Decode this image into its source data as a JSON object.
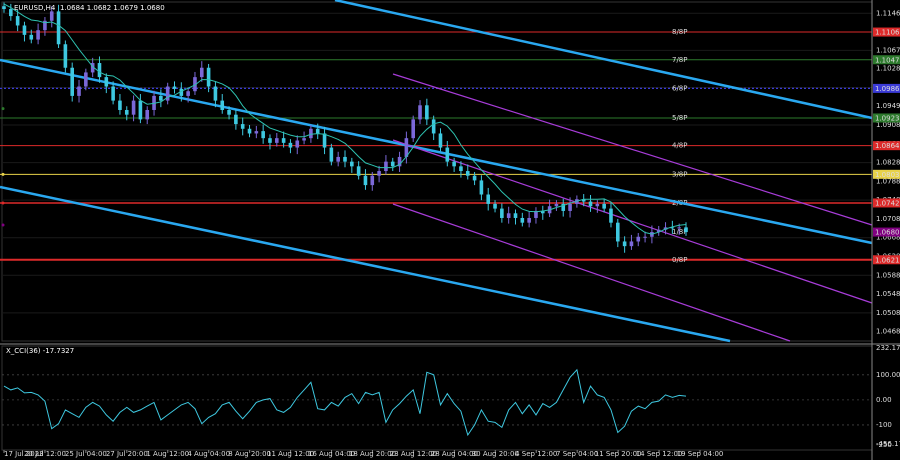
{
  "header": {
    "main_title": "EURUSD,H4",
    "main_ohlc": "1.0684 1.0682 1.0679 1.0680",
    "ind_title": "X_CCI(36) -17.7327"
  },
  "colors": {
    "bg": "#000000",
    "bull": "#7b68d8",
    "bear": "#3ec8e0",
    "ma": "#2ec2b0",
    "cyan_line": "#2aa8f0",
    "purple_line": "#a73cd8",
    "red": "#dd2a2a",
    "green": "#2d7a2d",
    "blue": "#3b3bd8",
    "yellow": "#e8d24a",
    "grid": "#1a1a1a",
    "axis": "#ffffff"
  },
  "chart_data": [
    {
      "type": "candlestick",
      "title": "EURUSD,H4",
      "ylim": [
        1.0448,
        1.117
      ],
      "y_ticks": [
        "1.1146",
        "1.1106",
        "1.1067",
        "1.1028",
        "1.0988",
        "1.0949",
        "1.0908",
        "1.0868",
        "1.0828",
        "1.0788",
        "1.0748",
        "1.0708",
        "1.0668",
        "1.0628",
        "1.0588",
        "1.0548",
        "1.0508",
        "1.0468"
      ],
      "x_ticks": [
        "17 Jul 2023",
        "20 Jul 12:00",
        "25 Jul 04:00",
        "27 Jul 20:00",
        "1 Aug 12:00",
        "4 Aug 04:00",
        "8 Aug 20:00",
        "11 Aug 12:00",
        "16 Aug 04:00",
        "18 Aug 20:00",
        "23 Aug 12:00",
        "28 Aug 04:00",
        "30 Aug 20:00",
        "4 Sep 12:00",
        "7 Sep 04:00",
        "11 Sep 20:00",
        "14 Sep 12:00",
        "19 Sep 04:00"
      ],
      "close": [
        1.1155,
        1.114,
        1.112,
        1.11,
        1.109,
        1.111,
        1.113,
        1.115,
        1.108,
        1.103,
        1.097,
        1.099,
        1.102,
        1.104,
        1.101,
        1.099,
        1.096,
        1.094,
        1.093,
        1.096,
        1.092,
        1.094,
        1.097,
        1.096,
        1.099,
        1.0985,
        1.097,
        1.098,
        1.101,
        1.103,
        1.099,
        1.096,
        1.094,
        1.093,
        1.091,
        1.09,
        1.089,
        1.0895,
        1.088,
        1.087,
        1.088,
        1.087,
        1.086,
        1.0875,
        1.088,
        1.09,
        1.089,
        1.086,
        1.083,
        1.084,
        1.083,
        1.082,
        1.08,
        1.078,
        1.08,
        1.081,
        1.083,
        1.082,
        1.084,
        1.088,
        1.092,
        1.095,
        1.092,
        1.089,
        1.086,
        1.083,
        1.082,
        1.081,
        1.08,
        1.079,
        1.076,
        1.074,
        1.073,
        1.071,
        1.072,
        1.071,
        1.07,
        1.071,
        1.0725,
        1.072,
        1.0735,
        1.074,
        1.0725,
        1.074,
        1.075,
        1.0745,
        1.0735,
        1.074,
        1.073,
        1.07,
        1.066,
        1.065,
        1.066,
        1.067,
        1.067,
        1.068,
        1.0685,
        1.069,
        1.0688,
        1.069,
        1.068
      ],
      "lines": [
        {
          "name": "1.0943",
          "value": 1.0943,
          "color": "green"
        },
        {
          "name": "1.0803",
          "value": 1.0803,
          "color": "yellow"
        },
        {
          "name": "1.0742",
          "value": 1.0742,
          "color": "red"
        },
        {
          "name": "1.0695",
          "value": 1.0695,
          "color": "purple"
        }
      ],
      "axis_labels": [
        {
          "text": "1.1106",
          "value": 1.1106,
          "color": "red"
        },
        {
          "text": "1.1047",
          "value": 1.1047,
          "color": "green"
        },
        {
          "text": "1.0986",
          "value": 1.0986,
          "color": "blue"
        },
        {
          "text": "1.0923",
          "value": 1.0923,
          "color": "green"
        },
        {
          "text": "1.0864",
          "value": 1.0864,
          "color": "red"
        },
        {
          "text": "1.0803",
          "value": 1.0803,
          "color": "yellow"
        },
        {
          "text": "1.0742",
          "value": 1.0742,
          "color": "red"
        },
        {
          "text": "1.0680",
          "value": 1.068,
          "color": "purple"
        },
        {
          "text": "1.0621",
          "value": 1.0621,
          "color": "red"
        }
      ],
      "level_labels": [
        "0/8P",
        "1/8P",
        "2/8P",
        "3/8P",
        "4/8P",
        "5/8P",
        "6/8P",
        "7/8P",
        "8/8P"
      ]
    },
    {
      "type": "line",
      "title": "X_CCI(36) -17.7327",
      "ylim": [
        -200,
        215
      ],
      "y_ticks": [
        "232.1705",
        "100.00",
        "0.00",
        "-100",
        "-250",
        "-456.1757"
      ],
      "values": [
        55,
        40,
        48,
        28,
        30,
        20,
        -5,
        -115,
        -95,
        -40,
        -55,
        -70,
        -30,
        -10,
        -25,
        -60,
        -85,
        -50,
        -30,
        -50,
        -40,
        -25,
        -10,
        -80,
        -60,
        -40,
        -20,
        -10,
        -35,
        -95,
        -70,
        -55,
        -20,
        -10,
        -45,
        -75,
        -45,
        -10,
        0,
        5,
        -40,
        -50,
        -30,
        10,
        40,
        70,
        -35,
        -40,
        -10,
        -25,
        10,
        25,
        -15,
        30,
        20,
        30,
        -90,
        -40,
        -15,
        15,
        40,
        -55,
        110,
        100,
        -20,
        25,
        -15,
        -45,
        -140,
        -100,
        -40,
        -85,
        -90,
        -110,
        -40,
        -10,
        -55,
        -20,
        -60,
        -15,
        -30,
        -10,
        40,
        90,
        120,
        -10,
        55,
        20,
        10,
        -40,
        -130,
        -105,
        -45,
        -25,
        -35,
        -10,
        -5,
        20,
        10,
        18,
        15
      ]
    }
  ]
}
